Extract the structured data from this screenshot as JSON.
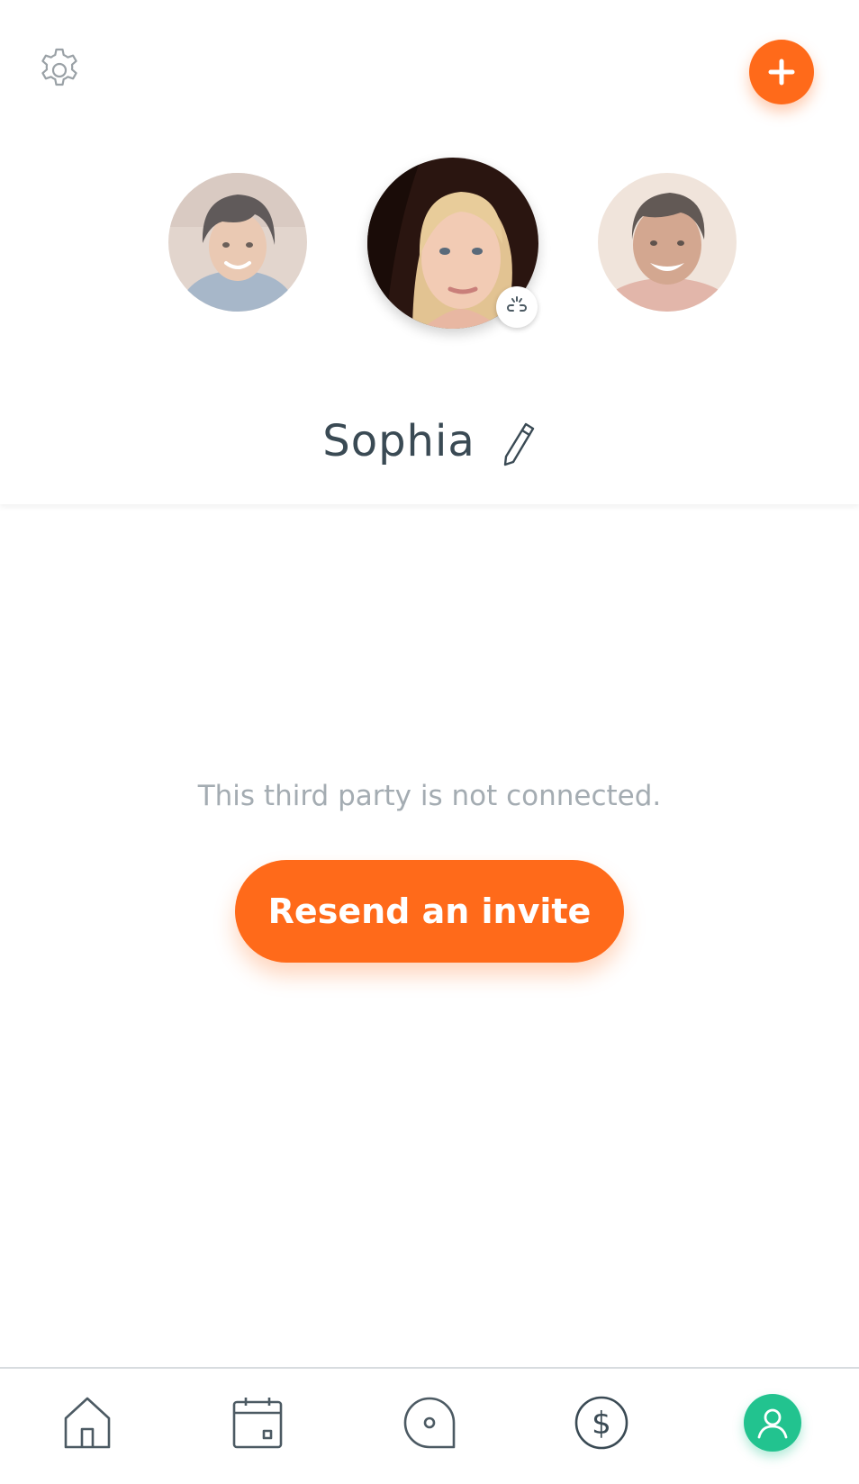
{
  "header": {
    "settings_icon": "gear-icon",
    "add_icon": "plus-icon",
    "selected_name": "Sophia",
    "edit_icon": "pencil-icon"
  },
  "avatars": [
    {
      "id": "child",
      "selected": false
    },
    {
      "id": "sophia",
      "selected": true,
      "badge_icon": "broken-link-icon"
    },
    {
      "id": "man",
      "selected": false
    }
  ],
  "main": {
    "status_text": "This third party is not connected.",
    "resend_label": "Resend an invite"
  },
  "tabbar": {
    "items": [
      {
        "icon": "home-icon",
        "active": false
      },
      {
        "icon": "calendar-icon",
        "active": false
      },
      {
        "icon": "chat-icon",
        "active": false
      },
      {
        "icon": "dollar-icon",
        "active": false
      },
      {
        "icon": "profile-icon",
        "active": true
      }
    ]
  },
  "colors": {
    "accent": "#ff6a1a",
    "active_tab": "#22c38f",
    "text_dark": "#3a4a54",
    "text_muted": "#a4acb2"
  }
}
